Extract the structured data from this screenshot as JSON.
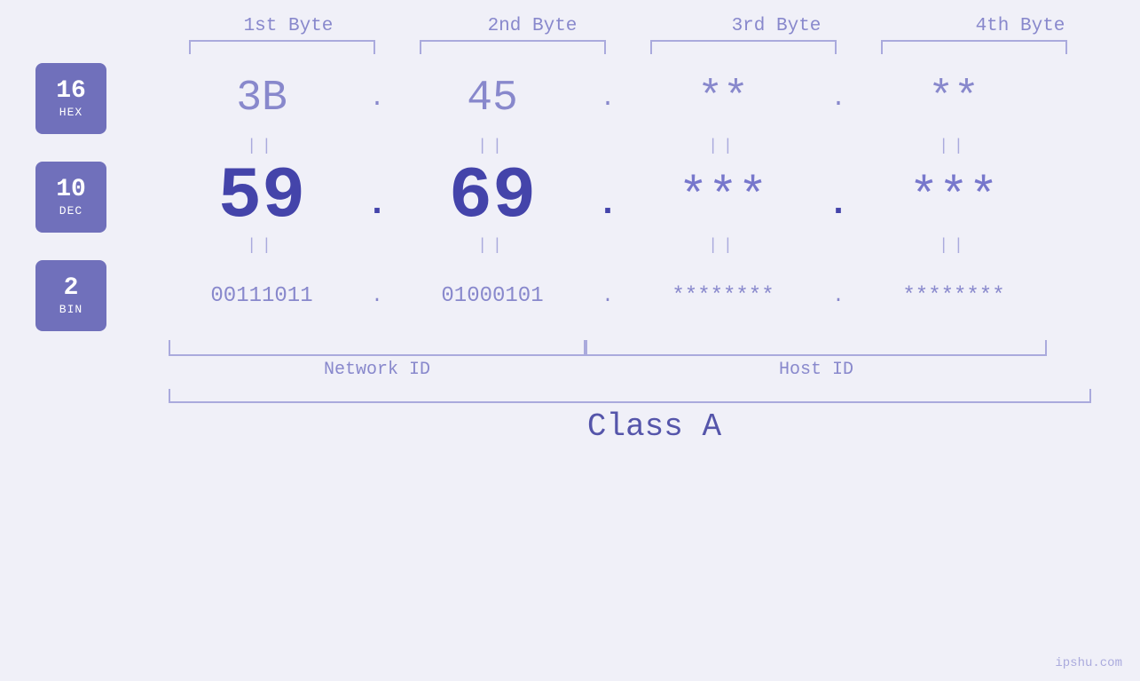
{
  "header": {
    "byte1": "1st Byte",
    "byte2": "2nd Byte",
    "byte3": "3rd Byte",
    "byte4": "4th Byte"
  },
  "bases": {
    "hex": {
      "num": "16",
      "name": "HEX"
    },
    "dec": {
      "num": "10",
      "name": "DEC"
    },
    "bin": {
      "num": "2",
      "name": "BIN"
    }
  },
  "values": {
    "hex": {
      "b1": "3B",
      "b2": "45",
      "b3": "**",
      "b4": "**",
      "sep": "."
    },
    "dec": {
      "b1": "59",
      "b2": "69",
      "b3": "***",
      "b4": "***",
      "sep": "."
    },
    "bin": {
      "b1": "00111011",
      "b2": "01000101",
      "b3": "********",
      "b4": "********",
      "sep": "."
    }
  },
  "labels": {
    "network_id": "Network ID",
    "host_id": "Host ID",
    "class": "Class A"
  },
  "watermark": "ipshu.com",
  "double_bar": "||"
}
